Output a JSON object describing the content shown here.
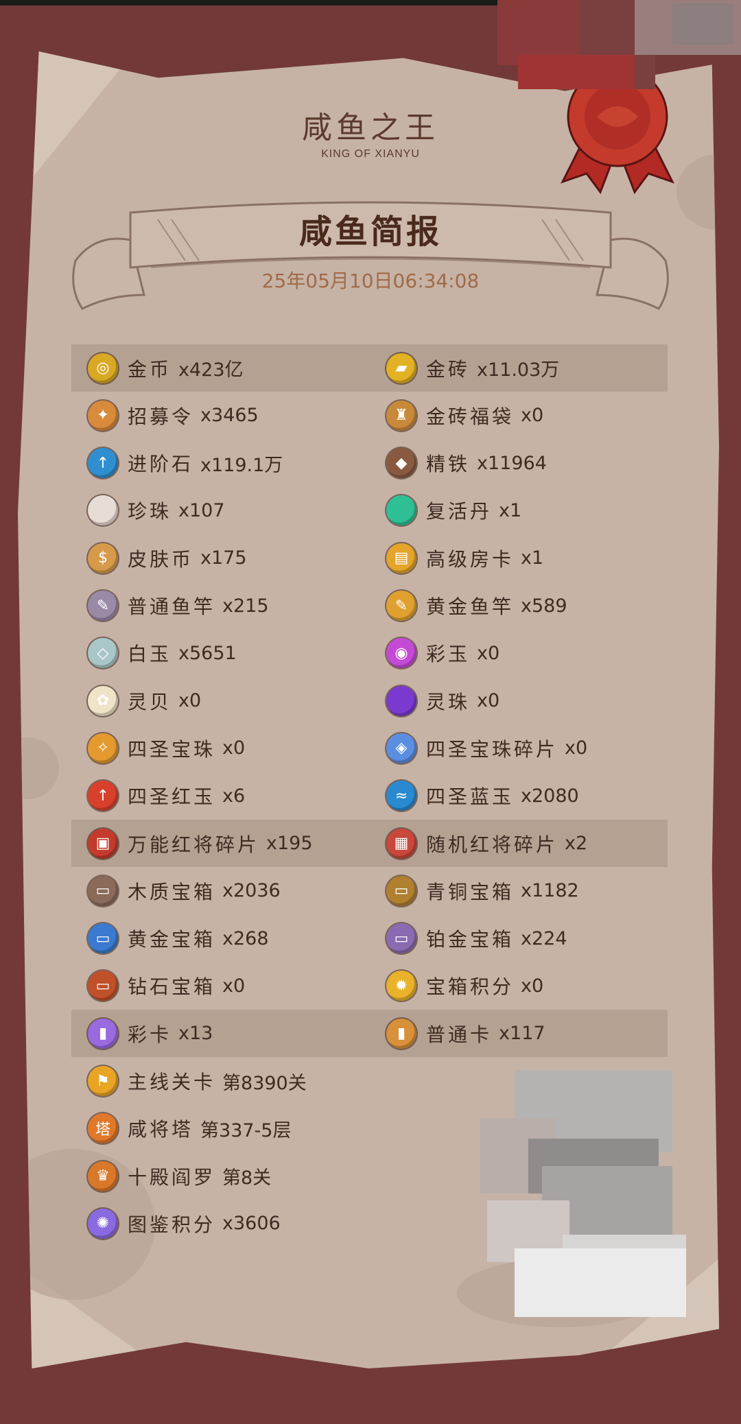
{
  "header": {
    "title": "咸鱼之王",
    "subtitle": "KING OF XIANYU"
  },
  "banner": {
    "title": "咸鱼简报",
    "date": "25年05月10日06:34:08"
  },
  "colors": {
    "background": "#73393a",
    "parchment": "#c6b3a6",
    "highlight_row": "#b09d8e",
    "text": "#3e2a21",
    "date_text": "#a06a48",
    "seal": "#c43a2c"
  },
  "items": [
    {
      "name": "金币",
      "value": "x423亿",
      "icon": "gold-coin-icon",
      "color": "#d9a824",
      "glyph": "◎",
      "highlight": true
    },
    {
      "name": "金砖",
      "value": "x11.03万",
      "icon": "gold-brick-icon",
      "color": "#e2b224",
      "glyph": "▰",
      "highlight": true
    },
    {
      "name": "招募令",
      "value": "x3465",
      "icon": "recruit-token-icon",
      "color": "#d98a3a",
      "glyph": "✦"
    },
    {
      "name": "金砖福袋",
      "value": "x0",
      "icon": "gold-bag-icon",
      "color": "#c88a3a",
      "glyph": "♜"
    },
    {
      "name": "进阶石",
      "value": "x119.1万",
      "icon": "advance-stone-icon",
      "color": "#2f8fd0",
      "glyph": "↑"
    },
    {
      "name": "精铁",
      "value": "x11964",
      "icon": "refined-iron-icon",
      "color": "#8a5a40",
      "glyph": "◆"
    },
    {
      "name": "珍珠",
      "value": "x107",
      "icon": "pearl-icon",
      "color": "#e8dcd6",
      "glyph": ""
    },
    {
      "name": "复活丹",
      "value": "x1",
      "icon": "revive-pill-icon",
      "color": "#2fbf95",
      "glyph": ""
    },
    {
      "name": "皮肤币",
      "value": "x175",
      "icon": "skin-coin-icon",
      "color": "#d79a4a",
      "glyph": "$"
    },
    {
      "name": "高级房卡",
      "value": "x1",
      "icon": "room-card-icon",
      "color": "#e4a52a",
      "glyph": "▤"
    },
    {
      "name": "普通鱼竿",
      "value": "x215",
      "icon": "fishing-rod-icon",
      "color": "#9a8aa8",
      "glyph": "✎"
    },
    {
      "name": "黄金鱼竿",
      "value": "x589",
      "icon": "golden-rod-icon",
      "color": "#e0a030",
      "glyph": "✎"
    },
    {
      "name": "白玉",
      "value": "x5651",
      "icon": "white-jade-icon",
      "color": "#a9c6c9",
      "glyph": "◇"
    },
    {
      "name": "彩玉",
      "value": "x0",
      "icon": "rainbow-jade-icon",
      "color": "#c44ad6",
      "glyph": "◉"
    },
    {
      "name": "灵贝",
      "value": "x0",
      "icon": "spirit-shell-icon",
      "color": "#efe4c8",
      "glyph": "✿"
    },
    {
      "name": "灵珠",
      "value": "x0",
      "icon": "spirit-orb-icon",
      "color": "#7a3ad0",
      "glyph": ""
    },
    {
      "name": "四圣宝珠",
      "value": "x0",
      "icon": "four-saint-orb-icon",
      "color": "#e49a2e",
      "glyph": "✧"
    },
    {
      "name": "四圣宝珠碎片",
      "value": "x0",
      "icon": "orb-fragment-icon",
      "color": "#5b8ee0",
      "glyph": "◈"
    },
    {
      "name": "四圣红玉",
      "value": "x6",
      "icon": "red-jade-icon",
      "color": "#d8402c",
      "glyph": "↑"
    },
    {
      "name": "四圣蓝玉",
      "value": "x2080",
      "icon": "blue-jade-icon",
      "color": "#2a8ad0",
      "glyph": "≈"
    },
    {
      "name": "万能红将碎片",
      "value": "x195",
      "icon": "red-general-fragment-icon",
      "color": "#c43a2c",
      "glyph": "▣",
      "highlight": true
    },
    {
      "name": "随机红将碎片",
      "value": "x2",
      "icon": "random-fragment-icon",
      "color": "#c9473b",
      "glyph": "▦",
      "highlight": true
    },
    {
      "name": "木质宝箱",
      "value": "x2036",
      "icon": "wooden-chest-icon",
      "color": "#8a6a58",
      "glyph": "▭"
    },
    {
      "name": "青铜宝箱",
      "value": "x1182",
      "icon": "bronze-chest-icon",
      "color": "#b08030",
      "glyph": "▭"
    },
    {
      "name": "黄金宝箱",
      "value": "x268",
      "icon": "gold-chest-icon",
      "color": "#3a7ad0",
      "glyph": "▭"
    },
    {
      "name": "铂金宝箱",
      "value": "x224",
      "icon": "platinum-chest-icon",
      "color": "#8a6ab0",
      "glyph": "▭"
    },
    {
      "name": "钻石宝箱",
      "value": "x0",
      "icon": "diamond-chest-icon",
      "color": "#c0502a",
      "glyph": "▭"
    },
    {
      "name": "宝箱积分",
      "value": "x0",
      "icon": "chest-points-icon",
      "color": "#e8b22a",
      "glyph": "✹"
    },
    {
      "name": "彩卡",
      "value": "x13",
      "icon": "rainbow-card-icon",
      "color": "#9a6ae0",
      "glyph": "▮",
      "highlight": true
    },
    {
      "name": "普通卡",
      "value": "x117",
      "icon": "normal-card-icon",
      "color": "#d9903a",
      "glyph": "▮",
      "highlight": true
    },
    {
      "name": "主线关卡",
      "value": "第8390关",
      "icon": "main-stage-icon",
      "color": "#e8a524",
      "glyph": "⚑"
    },
    {
      "name": "咸将塔",
      "value": "第337-5层",
      "icon": "tower-icon",
      "color": "#e0782a",
      "glyph": "塔"
    },
    {
      "name": "十殿阎罗",
      "value": "第8关",
      "icon": "ten-halls-icon",
      "color": "#d9782a",
      "glyph": "♛"
    },
    {
      "name": "图鉴积分",
      "value": "x3606",
      "icon": "collection-points-icon",
      "color": "#8a6ae0",
      "glyph": "✺"
    }
  ]
}
